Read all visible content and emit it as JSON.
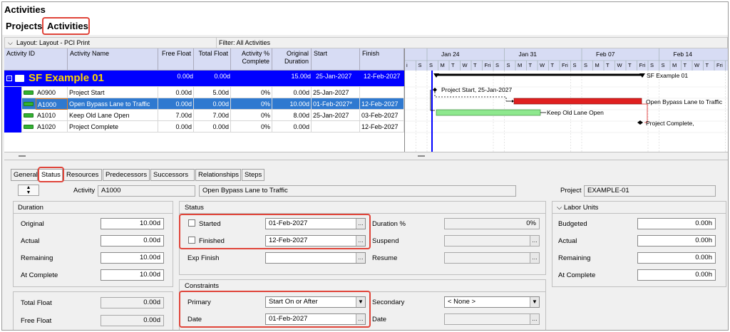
{
  "window": {
    "title": "Activities"
  },
  "nav": {
    "projects": "Projects",
    "activities": "Activities"
  },
  "layout_bar": {
    "layout": "Layout: Layout - PCI Print",
    "filter": "Filter: All Activities"
  },
  "columns": {
    "activity_id": "Activity ID",
    "activity_name": "Activity Name",
    "free_float": "Free Float",
    "total_float": "Total Float",
    "pct_complete_1": "Activity %",
    "pct_complete_2": "Complete",
    "orig_dur_1": "Original",
    "orig_dur_2": "Duration",
    "start": "Start",
    "finish": "Finish"
  },
  "project_row": {
    "name": "SF Example 01",
    "free_float": "0.00d",
    "total_float": "0.00d",
    "pct": "",
    "duration": "15.00d",
    "start": "25-Jan-2027",
    "finish": "12-Feb-2027"
  },
  "activities": [
    {
      "id": "A0900",
      "name": "Project Start",
      "free_float": "0.00d",
      "total_float": "5.00d",
      "pct": "0%",
      "duration": "0.00d",
      "start": "25-Jan-2027",
      "finish": ""
    },
    {
      "id": "A1000",
      "name": "Open Bypass Lane to Traffic",
      "free_float": "0.00d",
      "total_float": "0.00d",
      "pct": "0%",
      "duration": "10.00d",
      "start": "01-Feb-2027*",
      "finish": "12-Feb-2027"
    },
    {
      "id": "A1010",
      "name": "Keep Old Lane Open",
      "free_float": "7.00d",
      "total_float": "7.00d",
      "pct": "0%",
      "duration": "8.00d",
      "start": "25-Jan-2027",
      "finish": "03-Feb-2027"
    },
    {
      "id": "A1020",
      "name": "Project Complete",
      "free_float": "0.00d",
      "total_float": "0.00d",
      "pct": "0%",
      "duration": "0.00d",
      "start": "",
      "finish": "12-Feb-2027"
    }
  ],
  "gantt": {
    "weeks": [
      "Jan 24",
      "Jan 31",
      "Feb 07",
      "Feb 14"
    ],
    "first_day": "i",
    "days": [
      "S",
      "S",
      "M",
      "T",
      "W",
      "T",
      "Fri",
      "S",
      "S",
      "M",
      "T",
      "W",
      "T",
      "Fri",
      "S",
      "S",
      "M",
      "T",
      "W",
      "T",
      "Fri",
      "S",
      "S",
      "M",
      "T",
      "W",
      "T",
      "Fri",
      "S"
    ],
    "labels": {
      "summary": "SF Example 01",
      "start": "Project Start, 25-Jan-2027",
      "bypass": "Open Bypass Lane to Traffic",
      "old_lane": "Keep Old Lane Open",
      "complete": "Project Complete,"
    }
  },
  "detail_tabs": [
    "General",
    "Status",
    "Resources",
    "Predecessors",
    "Successors",
    "Relationships",
    "Steps"
  ],
  "detail": {
    "activity_label": "Activity",
    "activity_id": "A1000",
    "activity_name": "Open Bypass Lane to Traffic",
    "project_label": "Project",
    "project_value": "EXAMPLE-01",
    "duration": {
      "title": "Duration",
      "original_label": "Original",
      "original": "10.00d",
      "actual_label": "Actual",
      "actual": "0.00d",
      "remaining_label": "Remaining",
      "remaining": "10.00d",
      "at_complete_label": "At Complete",
      "at_complete": "10.00d"
    },
    "float": {
      "total_label": "Total Float",
      "total": "0.00d",
      "free_label": "Free Float",
      "free": "0.00d"
    },
    "status": {
      "title": "Status",
      "started_label": "Started",
      "started": "01-Feb-2027",
      "finished_label": "Finished",
      "finished": "12-Feb-2027",
      "exp_finish_label": "Exp Finish",
      "exp_finish": "",
      "duration_pct_label": "Duration %",
      "duration_pct": "0%",
      "suspend_label": "Suspend",
      "suspend": "",
      "resume_label": "Resume",
      "resume": ""
    },
    "constraints": {
      "title": "Constraints",
      "primary_label": "Primary",
      "primary": "Start On or After",
      "date_label": "Date",
      "date": "01-Feb-2027",
      "secondary_label": "Secondary",
      "secondary": "< None >",
      "date2_label": "Date",
      "date2": ""
    },
    "labor": {
      "title": "Labor Units",
      "budgeted_label": "Budgeted",
      "budgeted": "0.00h",
      "actual_label": "Actual",
      "actual": "0.00h",
      "remaining_label": "Remaining",
      "remaining": "0.00h",
      "at_complete_label": "At Complete",
      "at_complete": "0.00h"
    }
  },
  "colors": {
    "accent_blue": "#0000ff",
    "selected_row": "#2f79d0",
    "critical_bar": "#e02020",
    "noncritical_bar": "#8ee88e",
    "highlight": "#e0453a"
  },
  "icons": {
    "expand": "expand-minus-icon",
    "folder": "folder-icon",
    "activity": "activity-bar-icon",
    "ellipsis": "ellipsis-icon",
    "dropdown": "chevron-down-icon",
    "collapse": "chevron-up-icon"
  }
}
